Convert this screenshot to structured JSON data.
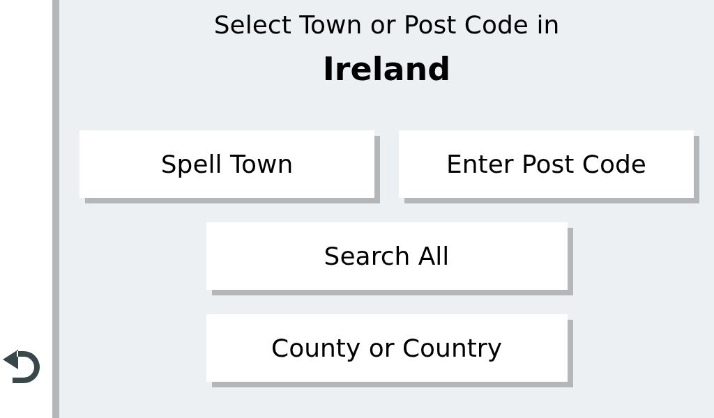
{
  "heading": "Select Town or Post Code in",
  "country": "Ireland",
  "options": [
    {
      "label": "Spell Town"
    },
    {
      "label": "Enter Post Code"
    },
    {
      "label": "Search All"
    },
    {
      "label": "County or Country"
    }
  ]
}
